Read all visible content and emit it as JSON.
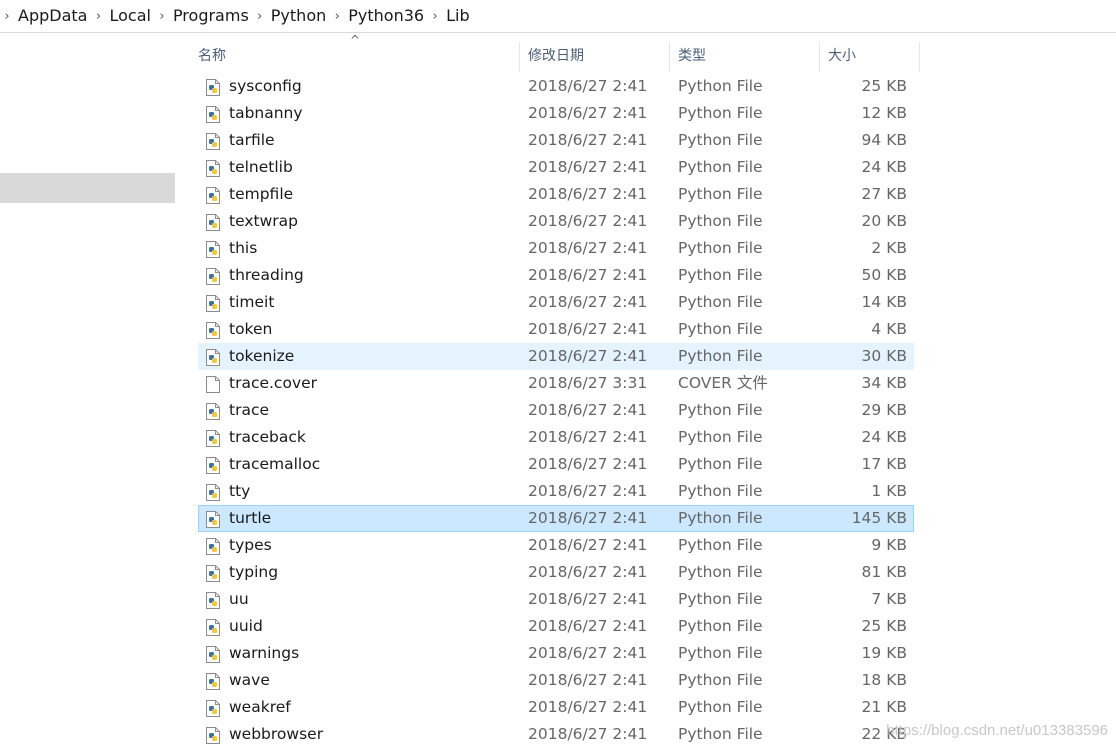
{
  "breadcrumb": [
    "AppData",
    "Local",
    "Programs",
    "Python",
    "Python36",
    "Lib"
  ],
  "columns": {
    "name": "名称",
    "date": "修改日期",
    "type": "类型",
    "size": "大小"
  },
  "files": [
    {
      "name": "sysconfig",
      "date": "2018/6/27 2:41",
      "type": "Python File",
      "size": "25 KB",
      "icon": "python-file-icon",
      "state": ""
    },
    {
      "name": "tabnanny",
      "date": "2018/6/27 2:41",
      "type": "Python File",
      "size": "12 KB",
      "icon": "python-file-icon",
      "state": ""
    },
    {
      "name": "tarfile",
      "date": "2018/6/27 2:41",
      "type": "Python File",
      "size": "94 KB",
      "icon": "python-file-icon",
      "state": ""
    },
    {
      "name": "telnetlib",
      "date": "2018/6/27 2:41",
      "type": "Python File",
      "size": "24 KB",
      "icon": "python-file-icon",
      "state": ""
    },
    {
      "name": "tempfile",
      "date": "2018/6/27 2:41",
      "type": "Python File",
      "size": "27 KB",
      "icon": "python-file-icon",
      "state": ""
    },
    {
      "name": "textwrap",
      "date": "2018/6/27 2:41",
      "type": "Python File",
      "size": "20 KB",
      "icon": "python-file-icon",
      "state": ""
    },
    {
      "name": "this",
      "date": "2018/6/27 2:41",
      "type": "Python File",
      "size": "2 KB",
      "icon": "python-file-icon",
      "state": ""
    },
    {
      "name": "threading",
      "date": "2018/6/27 2:41",
      "type": "Python File",
      "size": "50 KB",
      "icon": "python-file-icon",
      "state": ""
    },
    {
      "name": "timeit",
      "date": "2018/6/27 2:41",
      "type": "Python File",
      "size": "14 KB",
      "icon": "python-file-icon",
      "state": ""
    },
    {
      "name": "token",
      "date": "2018/6/27 2:41",
      "type": "Python File",
      "size": "4 KB",
      "icon": "python-file-icon",
      "state": ""
    },
    {
      "name": "tokenize",
      "date": "2018/6/27 2:41",
      "type": "Python File",
      "size": "30 KB",
      "icon": "python-file-icon",
      "state": "hover"
    },
    {
      "name": "trace.cover",
      "date": "2018/6/27 3:31",
      "type": "COVER 文件",
      "size": "34 KB",
      "icon": "blank-file-icon",
      "state": ""
    },
    {
      "name": "trace",
      "date": "2018/6/27 2:41",
      "type": "Python File",
      "size": "29 KB",
      "icon": "python-file-icon",
      "state": ""
    },
    {
      "name": "traceback",
      "date": "2018/6/27 2:41",
      "type": "Python File",
      "size": "24 KB",
      "icon": "python-file-icon",
      "state": ""
    },
    {
      "name": "tracemalloc",
      "date": "2018/6/27 2:41",
      "type": "Python File",
      "size": "17 KB",
      "icon": "python-file-icon",
      "state": ""
    },
    {
      "name": "tty",
      "date": "2018/6/27 2:41",
      "type": "Python File",
      "size": "1 KB",
      "icon": "python-file-icon",
      "state": ""
    },
    {
      "name": "turtle",
      "date": "2018/6/27 2:41",
      "type": "Python File",
      "size": "145 KB",
      "icon": "python-file-icon",
      "state": "selected"
    },
    {
      "name": "types",
      "date": "2018/6/27 2:41",
      "type": "Python File",
      "size": "9 KB",
      "icon": "python-file-icon",
      "state": ""
    },
    {
      "name": "typing",
      "date": "2018/6/27 2:41",
      "type": "Python File",
      "size": "81 KB",
      "icon": "python-file-icon",
      "state": ""
    },
    {
      "name": "uu",
      "date": "2018/6/27 2:41",
      "type": "Python File",
      "size": "7 KB",
      "icon": "python-file-icon",
      "state": ""
    },
    {
      "name": "uuid",
      "date": "2018/6/27 2:41",
      "type": "Python File",
      "size": "25 KB",
      "icon": "python-file-icon",
      "state": ""
    },
    {
      "name": "warnings",
      "date": "2018/6/27 2:41",
      "type": "Python File",
      "size": "19 KB",
      "icon": "python-file-icon",
      "state": ""
    },
    {
      "name": "wave",
      "date": "2018/6/27 2:41",
      "type": "Python File",
      "size": "18 KB",
      "icon": "python-file-icon",
      "state": ""
    },
    {
      "name": "weakref",
      "date": "2018/6/27 2:41",
      "type": "Python File",
      "size": "21 KB",
      "icon": "python-file-icon",
      "state": ""
    },
    {
      "name": "webbrowser",
      "date": "2018/6/27 2:41",
      "type": "Python File",
      "size": "22 KB",
      "icon": "python-file-icon",
      "state": ""
    }
  ],
  "watermark": "https://blog.csdn.net/u013383596",
  "colors": {
    "hover": "#e5f3ff",
    "selected": "#cce8ff",
    "selected_border": "#99d1ff",
    "header_text": "#4c607a",
    "nav_selected": "#d9d9d9"
  }
}
